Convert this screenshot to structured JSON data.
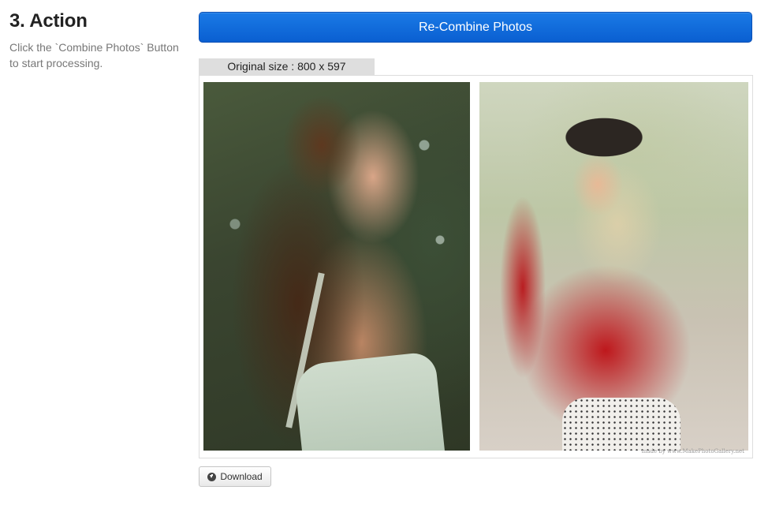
{
  "step": {
    "title": "3. Action",
    "description": "Click the `Combine Photos` Button to start processing."
  },
  "actions": {
    "combine_label": "Re-Combine Photos",
    "download_label": "Download",
    "download_icon": "download-circle-icon"
  },
  "preview": {
    "size_label": "Original size : 800 x 597",
    "watermark": "made by www.MakePhotoGallery.net",
    "images": [
      {
        "description_name": "woman-with-flowers-photo"
      },
      {
        "description_name": "woman-red-sweater-photo"
      }
    ]
  },
  "colors": {
    "primary_button": "#0a5fd1",
    "tab_background": "#dedede",
    "muted_text": "#777777"
  }
}
